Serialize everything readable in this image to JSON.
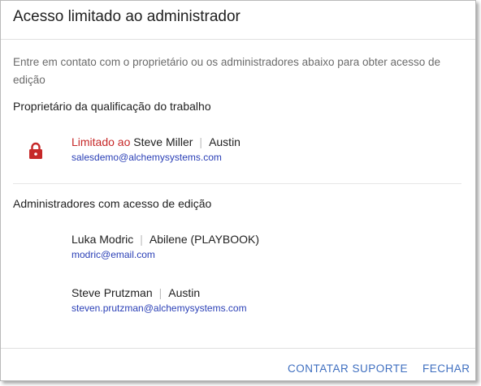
{
  "dialog": {
    "title": "Acesso limitado ao administrador"
  },
  "intro": "Entre em contato com o proprietário ou os administradores abaixo para obter acesso de edição",
  "owner_section": {
    "title": "Proprietário da qualificação do trabalho",
    "lock_icon": "lock-icon",
    "lock_color": "#c62828",
    "limited_label": "Limitado ao",
    "name": "Steve Miller",
    "separator": "|",
    "location": "Austin",
    "email": "salesdemo@alchemysystems.com"
  },
  "admins_section": {
    "title": "Administradores com acesso de edição",
    "admins": [
      {
        "name": "Luka Modric",
        "separator": "|",
        "location": "Abilene (PLAYBOOK)",
        "email": "modric@email.com"
      },
      {
        "name": "Steve Prutzman",
        "separator": "|",
        "location": "Austin",
        "email": "steven.prutzman@alchemysystems.com"
      }
    ]
  },
  "footer": {
    "contact_support": "CONTATAR SUPORTE",
    "close": "FECHAR"
  },
  "colors": {
    "accent": "#3f6fc0",
    "email_link": "#2a3fb6",
    "limited": "#c62828"
  }
}
